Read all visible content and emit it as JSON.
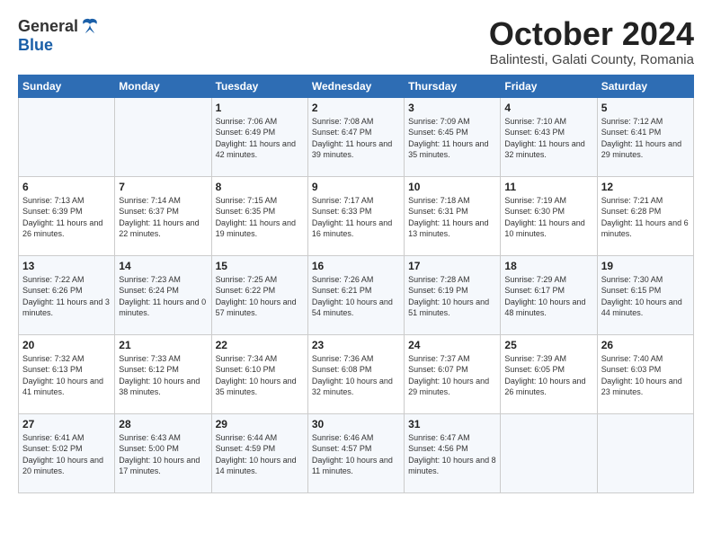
{
  "logo": {
    "general": "General",
    "blue": "Blue"
  },
  "title": "October 2024",
  "subtitle": "Balintesti, Galati County, Romania",
  "days_header": [
    "Sunday",
    "Monday",
    "Tuesday",
    "Wednesday",
    "Thursday",
    "Friday",
    "Saturday"
  ],
  "weeks": [
    [
      {
        "day": "",
        "info": ""
      },
      {
        "day": "",
        "info": ""
      },
      {
        "day": "1",
        "info": "Sunrise: 7:06 AM\nSunset: 6:49 PM\nDaylight: 11 hours and 42 minutes."
      },
      {
        "day": "2",
        "info": "Sunrise: 7:08 AM\nSunset: 6:47 PM\nDaylight: 11 hours and 39 minutes."
      },
      {
        "day": "3",
        "info": "Sunrise: 7:09 AM\nSunset: 6:45 PM\nDaylight: 11 hours and 35 minutes."
      },
      {
        "day": "4",
        "info": "Sunrise: 7:10 AM\nSunset: 6:43 PM\nDaylight: 11 hours and 32 minutes."
      },
      {
        "day": "5",
        "info": "Sunrise: 7:12 AM\nSunset: 6:41 PM\nDaylight: 11 hours and 29 minutes."
      }
    ],
    [
      {
        "day": "6",
        "info": "Sunrise: 7:13 AM\nSunset: 6:39 PM\nDaylight: 11 hours and 26 minutes."
      },
      {
        "day": "7",
        "info": "Sunrise: 7:14 AM\nSunset: 6:37 PM\nDaylight: 11 hours and 22 minutes."
      },
      {
        "day": "8",
        "info": "Sunrise: 7:15 AM\nSunset: 6:35 PM\nDaylight: 11 hours and 19 minutes."
      },
      {
        "day": "9",
        "info": "Sunrise: 7:17 AM\nSunset: 6:33 PM\nDaylight: 11 hours and 16 minutes."
      },
      {
        "day": "10",
        "info": "Sunrise: 7:18 AM\nSunset: 6:31 PM\nDaylight: 11 hours and 13 minutes."
      },
      {
        "day": "11",
        "info": "Sunrise: 7:19 AM\nSunset: 6:30 PM\nDaylight: 11 hours and 10 minutes."
      },
      {
        "day": "12",
        "info": "Sunrise: 7:21 AM\nSunset: 6:28 PM\nDaylight: 11 hours and 6 minutes."
      }
    ],
    [
      {
        "day": "13",
        "info": "Sunrise: 7:22 AM\nSunset: 6:26 PM\nDaylight: 11 hours and 3 minutes."
      },
      {
        "day": "14",
        "info": "Sunrise: 7:23 AM\nSunset: 6:24 PM\nDaylight: 11 hours and 0 minutes."
      },
      {
        "day": "15",
        "info": "Sunrise: 7:25 AM\nSunset: 6:22 PM\nDaylight: 10 hours and 57 minutes."
      },
      {
        "day": "16",
        "info": "Sunrise: 7:26 AM\nSunset: 6:21 PM\nDaylight: 10 hours and 54 minutes."
      },
      {
        "day": "17",
        "info": "Sunrise: 7:28 AM\nSunset: 6:19 PM\nDaylight: 10 hours and 51 minutes."
      },
      {
        "day": "18",
        "info": "Sunrise: 7:29 AM\nSunset: 6:17 PM\nDaylight: 10 hours and 48 minutes."
      },
      {
        "day": "19",
        "info": "Sunrise: 7:30 AM\nSunset: 6:15 PM\nDaylight: 10 hours and 44 minutes."
      }
    ],
    [
      {
        "day": "20",
        "info": "Sunrise: 7:32 AM\nSunset: 6:13 PM\nDaylight: 10 hours and 41 minutes."
      },
      {
        "day": "21",
        "info": "Sunrise: 7:33 AM\nSunset: 6:12 PM\nDaylight: 10 hours and 38 minutes."
      },
      {
        "day": "22",
        "info": "Sunrise: 7:34 AM\nSunset: 6:10 PM\nDaylight: 10 hours and 35 minutes."
      },
      {
        "day": "23",
        "info": "Sunrise: 7:36 AM\nSunset: 6:08 PM\nDaylight: 10 hours and 32 minutes."
      },
      {
        "day": "24",
        "info": "Sunrise: 7:37 AM\nSunset: 6:07 PM\nDaylight: 10 hours and 29 minutes."
      },
      {
        "day": "25",
        "info": "Sunrise: 7:39 AM\nSunset: 6:05 PM\nDaylight: 10 hours and 26 minutes."
      },
      {
        "day": "26",
        "info": "Sunrise: 7:40 AM\nSunset: 6:03 PM\nDaylight: 10 hours and 23 minutes."
      }
    ],
    [
      {
        "day": "27",
        "info": "Sunrise: 6:41 AM\nSunset: 5:02 PM\nDaylight: 10 hours and 20 minutes."
      },
      {
        "day": "28",
        "info": "Sunrise: 6:43 AM\nSunset: 5:00 PM\nDaylight: 10 hours and 17 minutes."
      },
      {
        "day": "29",
        "info": "Sunrise: 6:44 AM\nSunset: 4:59 PM\nDaylight: 10 hours and 14 minutes."
      },
      {
        "day": "30",
        "info": "Sunrise: 6:46 AM\nSunset: 4:57 PM\nDaylight: 10 hours and 11 minutes."
      },
      {
        "day": "31",
        "info": "Sunrise: 6:47 AM\nSunset: 4:56 PM\nDaylight: 10 hours and 8 minutes."
      },
      {
        "day": "",
        "info": ""
      },
      {
        "day": "",
        "info": ""
      }
    ]
  ]
}
